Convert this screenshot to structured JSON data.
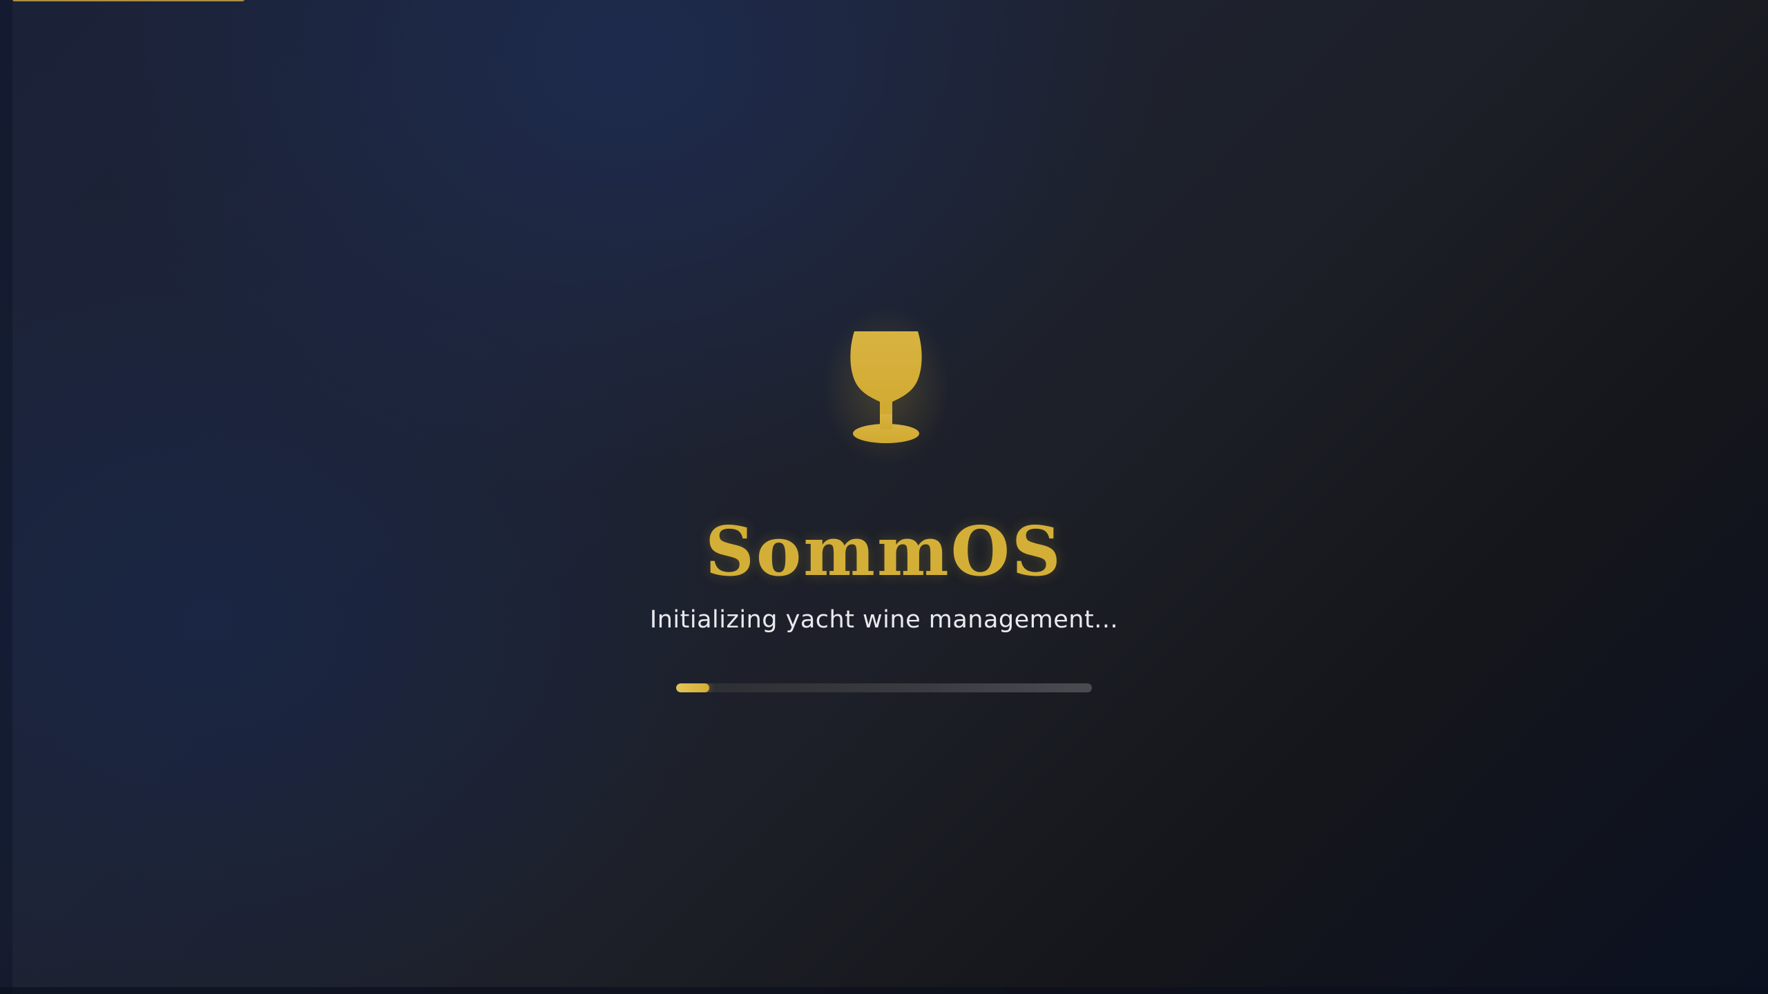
{
  "app": {
    "title": "SommOS",
    "logo_icon": "wine-glass-icon"
  },
  "loading": {
    "status_text": "Initializing yacht wine management...",
    "progress_fraction": 0.08
  },
  "colors": {
    "accent_gold": "#d4af37",
    "text_light": "#e9e9ee",
    "background_navy": "#1b2238",
    "background_dark": "#15161b"
  }
}
